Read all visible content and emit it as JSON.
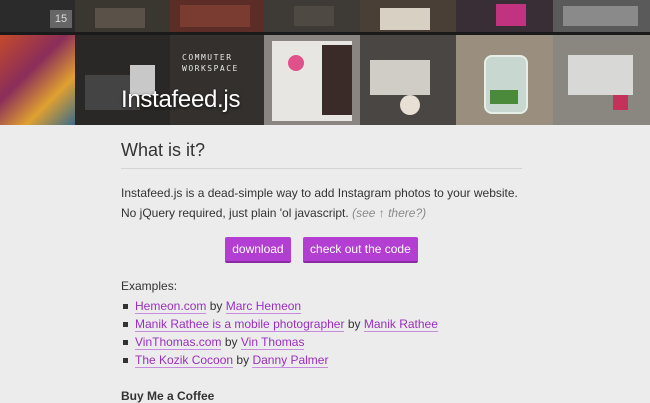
{
  "hero": {
    "title": "Instafeed.js",
    "tile_text": "COMMUTER WORKSPACE"
  },
  "main": {
    "section_title": "What is it?",
    "intro_text": "Instafeed.js is a dead-simple way to add Instagram photos to your website. No jQuery required, just plain 'ol javascript.",
    "intro_note": "(see ↑ there?)",
    "buttons": {
      "download": "download",
      "code": "check out the code"
    },
    "examples_label": "Examples:",
    "examples": [
      {
        "site": "Hemeon.com",
        "by": "by",
        "author": "Marc Hemeon"
      },
      {
        "site": "Manik Rathee is a mobile photographer",
        "by": "by",
        "author": "Manik Rathee"
      },
      {
        "site": "VinThomas.com",
        "by": "by",
        "author": "Vin Thomas"
      },
      {
        "site": "The Kozik Cocoon",
        "by": "by",
        "author": "Danny Palmer"
      }
    ],
    "coffee_heading": "Buy Me a Coffee"
  },
  "colors": {
    "accent": "#b23fd1",
    "link": "#9b2fc0",
    "background": "#ececec"
  }
}
